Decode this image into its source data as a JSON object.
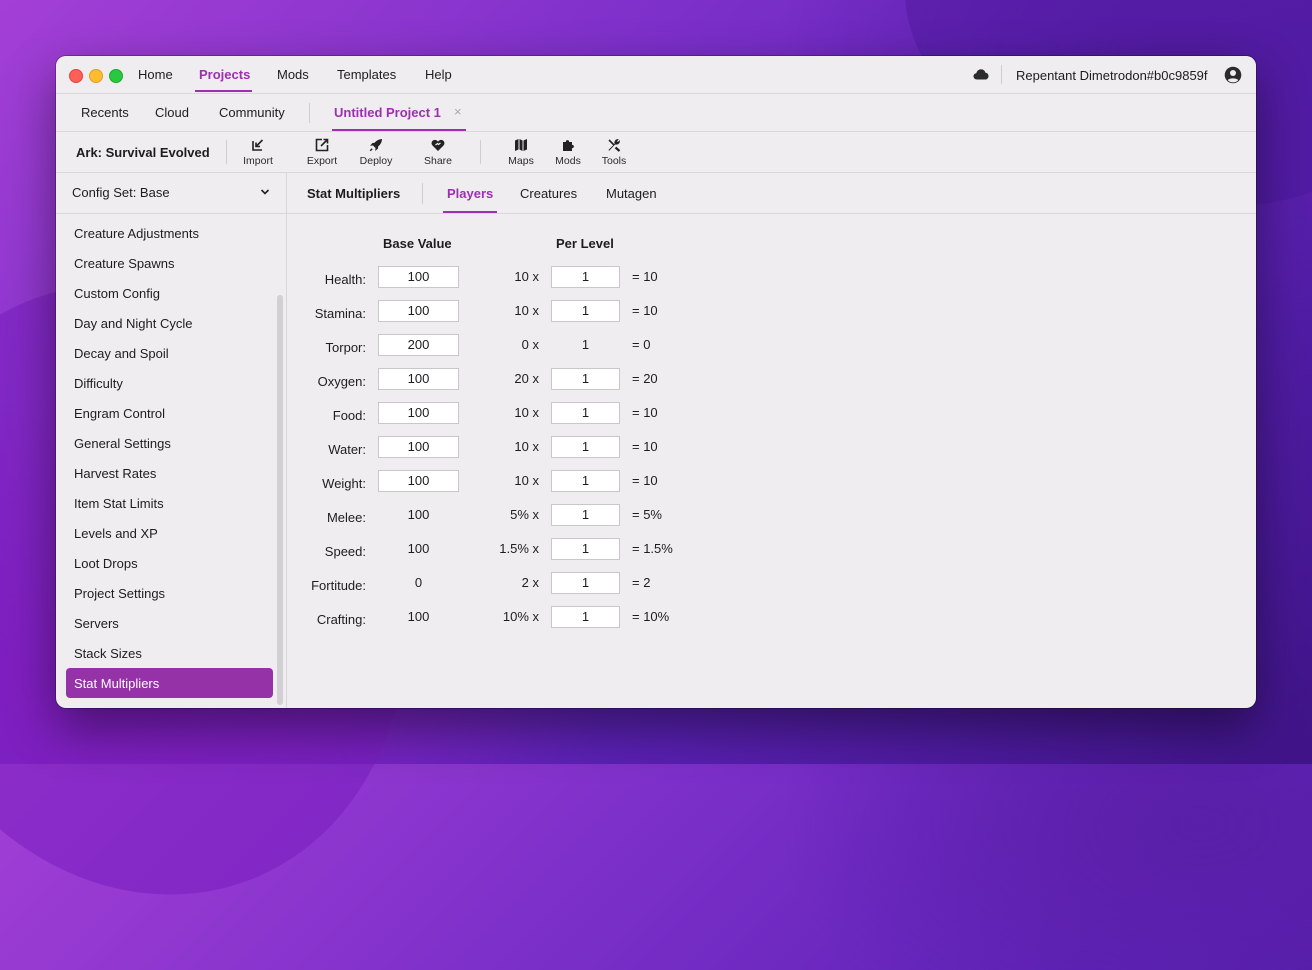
{
  "nav": {
    "items": [
      "Home",
      "Projects",
      "Mods",
      "Templates",
      "Help"
    ],
    "active": "Projects",
    "user": "Repentant Dimetrodon#b0c9859f"
  },
  "tabs": {
    "items": [
      "Recents",
      "Cloud",
      "Community"
    ],
    "project": "Untitled Project 1",
    "close": "×"
  },
  "toolbar": {
    "game": "Ark: Survival Evolved",
    "import": "Import",
    "export": "Export",
    "deploy": "Deploy",
    "share": "Share",
    "maps": "Maps",
    "mods": "Mods",
    "tools": "Tools"
  },
  "sidebar": {
    "config_set": "Config Set: Base",
    "items": [
      "Creature Adjustments",
      "Creature Spawns",
      "Custom Config",
      "Day and Night Cycle",
      "Decay and Spoil",
      "Difficulty",
      "Engram Control",
      "General Settings",
      "Harvest Rates",
      "Item Stat Limits",
      "Levels and XP",
      "Loot Drops",
      "Project Settings",
      "Servers",
      "Stack Sizes",
      "Stat Multipliers"
    ],
    "active": "Stat Multipliers"
  },
  "content": {
    "title": "Stat Multipliers",
    "tabs": [
      "Players",
      "Creatures",
      "Mutagen"
    ],
    "active_tab": "Players",
    "header_base": "Base Value",
    "header_level": "Per Level",
    "rows": [
      {
        "label": "Health:",
        "base": "100",
        "base_editable": true,
        "mult": "10 x",
        "level": "1",
        "level_editable": true,
        "result": "= 10"
      },
      {
        "label": "Stamina:",
        "base": "100",
        "base_editable": true,
        "mult": "10 x",
        "level": "1",
        "level_editable": true,
        "result": "= 10"
      },
      {
        "label": "Torpor:",
        "base": "200",
        "base_editable": true,
        "mult": "0 x",
        "level": "1",
        "level_editable": false,
        "result": "= 0"
      },
      {
        "label": "Oxygen:",
        "base": "100",
        "base_editable": true,
        "mult": "20 x",
        "level": "1",
        "level_editable": true,
        "result": "= 20"
      },
      {
        "label": "Food:",
        "base": "100",
        "base_editable": true,
        "mult": "10 x",
        "level": "1",
        "level_editable": true,
        "result": "= 10"
      },
      {
        "label": "Water:",
        "base": "100",
        "base_editable": true,
        "mult": "10 x",
        "level": "1",
        "level_editable": true,
        "result": "= 10"
      },
      {
        "label": "Weight:",
        "base": "100",
        "base_editable": true,
        "mult": "10 x",
        "level": "1",
        "level_editable": true,
        "result": "= 10"
      },
      {
        "label": "Melee:",
        "base": "100",
        "base_editable": false,
        "mult": "5% x",
        "level": "1",
        "level_editable": true,
        "result": "= 5%"
      },
      {
        "label": "Speed:",
        "base": "100",
        "base_editable": false,
        "mult": "1.5% x",
        "level": "1",
        "level_editable": true,
        "result": "= 1.5%"
      },
      {
        "label": "Fortitude:",
        "base": "0",
        "base_editable": false,
        "mult": "2 x",
        "level": "1",
        "level_editable": true,
        "result": "= 2"
      },
      {
        "label": "Crafting:",
        "base": "100",
        "base_editable": false,
        "mult": "10% x",
        "level": "1",
        "level_editable": true,
        "result": "= 10%"
      }
    ]
  },
  "colors": {
    "accent": "#9d2fb0",
    "sidebar_active": "#9632a8"
  }
}
